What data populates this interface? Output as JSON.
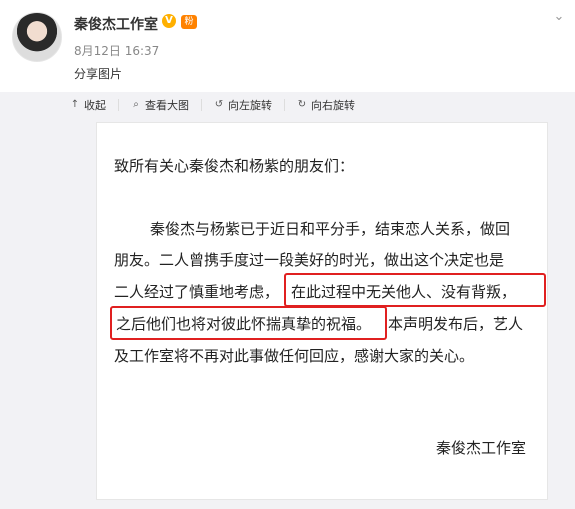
{
  "post": {
    "author": "秦俊杰工作室",
    "time": "8月12日 16:37",
    "source": "分享图片",
    "badges": {
      "v": "V",
      "fans": "粉"
    }
  },
  "toolbar": {
    "items": [
      {
        "label": "收起",
        "icon": "collapse-icon"
      },
      {
        "label": "查看大图",
        "icon": "zoom-icon"
      },
      {
        "label": "向左旋转",
        "icon": "rotate-left-icon"
      },
      {
        "label": "向右旋转",
        "icon": "rotate-right-icon"
      }
    ]
  },
  "letter": {
    "title": "致所有关心秦俊杰和杨紫的朋友们：",
    "lines": [
      "秦俊杰与杨紫已于近日和平分手，结束恋人关系，做回",
      "朋友。二人曾携手度过一段美好的时光，做出这个决定也是",
      "二人经过了慎重地考虑，",
      "在此过程中无关他人、没有背叛，",
      "之后他们也将对彼此怀揣真挚的祝福。",
      "本声明发布后，艺人",
      "及工作室将不再对此事做任何回应，感谢大家的关心。"
    ],
    "signature": "秦俊杰工作室"
  },
  "colors": {
    "highlight": "#e02020",
    "band": "#f2f2f5"
  }
}
